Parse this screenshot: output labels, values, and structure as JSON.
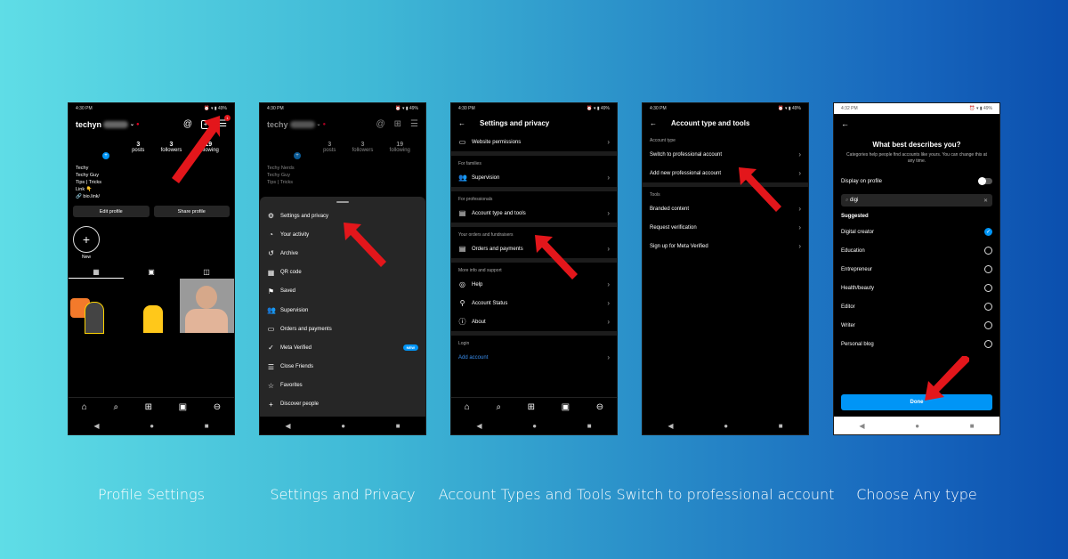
{
  "status_bar": {
    "time_1": "4:30 PM",
    "time_5": "4:32 PM",
    "battery": "49%"
  },
  "phone1": {
    "username": "techyn",
    "stats": [
      {
        "value": "3",
        "label": "posts"
      },
      {
        "value": "3",
        "label": "followers"
      },
      {
        "value": "19",
        "label": "following"
      }
    ],
    "bio": [
      "Techy",
      "Techy Guy",
      "Tips | Tricks",
      "Link 👇",
      "bio.link/"
    ],
    "edit_profile": "Edit profile",
    "share_profile": "Share profile",
    "highlight_new": "New",
    "notification_count": "1"
  },
  "phone2": {
    "username": "techy",
    "stats": [
      {
        "value": "3",
        "label": "posts"
      },
      {
        "value": "3",
        "label": "followers"
      },
      {
        "value": "19",
        "label": "following"
      }
    ],
    "bio": [
      "Techy Nerds",
      "Techy Guy",
      "Tips | Tricks"
    ],
    "menu": [
      {
        "icon": "gear-icon",
        "glyph": "⚙",
        "label": "Settings and privacy"
      },
      {
        "icon": "activity-icon",
        "glyph": "◔",
        "label": "Your activity"
      },
      {
        "icon": "archive-icon",
        "glyph": "↺",
        "label": "Archive"
      },
      {
        "icon": "qr-code-icon",
        "glyph": "▦",
        "label": "QR code"
      },
      {
        "icon": "bookmark-icon",
        "glyph": "⚑",
        "label": "Saved"
      },
      {
        "icon": "supervision-icon",
        "glyph": "👥",
        "label": "Supervision"
      },
      {
        "icon": "card-icon",
        "glyph": "▭",
        "label": "Orders and payments"
      },
      {
        "icon": "verified-icon",
        "glyph": "✓",
        "label": "Meta Verified",
        "badge": "NEW"
      },
      {
        "icon": "list-icon",
        "glyph": "☰",
        "label": "Close Friends"
      },
      {
        "icon": "star-icon",
        "glyph": "☆",
        "label": "Favorites"
      },
      {
        "icon": "add-person-icon",
        "glyph": "+",
        "label": "Discover people"
      }
    ]
  },
  "phone3": {
    "title": "Settings and privacy",
    "website_permissions": "Website permissions",
    "sec_families": "For families",
    "supervision": "Supervision",
    "sec_professionals": "For professionals",
    "account_type_tools": "Account type and tools",
    "sec_orders": "Your orders and fundraisers",
    "orders_payments": "Orders and payments",
    "sec_more": "More info and support",
    "help": "Help",
    "account_status": "Account Status",
    "about": "About",
    "sec_login": "Login",
    "add_account": "Add account"
  },
  "phone4": {
    "title": "Account type and tools",
    "sec_account_type": "Account type",
    "switch_pro": "Switch to professional account",
    "add_pro": "Add new professional account",
    "sec_tools": "Tools",
    "branded": "Branded content",
    "request_verification": "Request verification",
    "meta_verified": "Sign up for Meta Verified"
  },
  "phone5": {
    "title": "What best describes you?",
    "subtitle": "Categories help people find accounts like yours. You can change this at any time.",
    "display_on_profile": "Display on profile",
    "display_toggle": false,
    "search_value": "digi",
    "suggested": "Suggested",
    "options": [
      {
        "label": "Digital creator",
        "selected": true
      },
      {
        "label": "Education",
        "selected": false
      },
      {
        "label": "Entrepreneur",
        "selected": false
      },
      {
        "label": "Health/beauty",
        "selected": false
      },
      {
        "label": "Editor",
        "selected": false
      },
      {
        "label": "Writer",
        "selected": false
      },
      {
        "label": "Personal blog",
        "selected": false
      }
    ],
    "done": "Done"
  },
  "captions": [
    "Profile Settings",
    "Settings and Privacy",
    "Account Types and Tools",
    "Switch to professional account",
    "Choose Any type"
  ],
  "colors": {
    "accent": "#0095f6",
    "arrow": "#e3161b",
    "bg_start": "#5fdde6",
    "bg_end": "#0b4fae"
  }
}
